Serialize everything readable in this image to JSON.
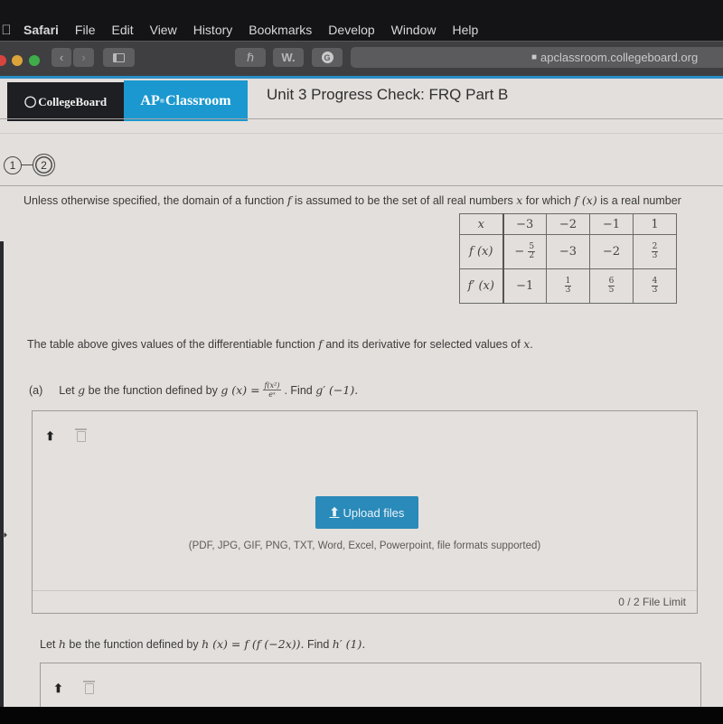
{
  "menubar": {
    "apple_icon": "apple-icon",
    "items": [
      "Safari",
      "File",
      "Edit",
      "View",
      "History",
      "Bookmarks",
      "Develop",
      "Window",
      "Help"
    ]
  },
  "toolbar": {
    "back_glyph": "‹",
    "forward_glyph": "›",
    "ext1_glyph": "ℏ",
    "ext2_label": "W.",
    "ext3_glyph": "G",
    "url": "apclassroom.collegeboard.org",
    "lock_glyph": "🔒"
  },
  "header": {
    "brand": "CollegeBoard",
    "brand_icon": "acorn-shield-icon",
    "app_prefix": "AP",
    "app_sup": "®",
    "app_name": "Classroom",
    "title": "Unit 3 Progress Check: FRQ Part B"
  },
  "stepper": {
    "steps": [
      "1",
      "2"
    ],
    "current": "2"
  },
  "question": {
    "intro_prefix": "Unless otherwise specified, the domain of a function",
    "intro_f": "f",
    "intro_mid": "is assumed to be the set of all real numbers",
    "intro_x": "x",
    "intro_mid2": "for which",
    "intro_fx": "f (x)",
    "intro_suffix": "is a real number",
    "table": {
      "header_label": "x",
      "x_values": [
        "−3",
        "−2",
        "−1",
        "1"
      ],
      "rows": [
        {
          "label": "f (x)",
          "cells": [
            {
              "sign": "−",
              "num": "5",
              "den": "2"
            },
            {
              "text": "−3"
            },
            {
              "text": "−2"
            },
            {
              "num": "2",
              "den": "3"
            }
          ]
        },
        {
          "label": "f′ (x)",
          "cells": [
            {
              "text": "−1"
            },
            {
              "num": "1",
              "den": "3"
            },
            {
              "num": "6",
              "den": "5"
            },
            {
              "num": "4",
              "den": "3"
            }
          ]
        }
      ]
    },
    "caption_prefix": "The table above gives values of the differentiable function",
    "caption_f": "f",
    "caption_mid": "and its derivative for selected values of",
    "caption_x": "x",
    "caption_end": ".",
    "part_a": {
      "label": "(a)",
      "text_prefix": "Let",
      "g": "g",
      "text_mid": "be the function defined by",
      "lhs": "g (x) =",
      "frac_num": "f(x²)",
      "frac_den": "eˣ",
      "text_find": ". Find",
      "target": "g′ (−1)."
    },
    "part_b": {
      "text_prefix": "Let",
      "h": "h",
      "text_mid": "be the function defined by",
      "expr": "h (x) = f (f (−2x)).",
      "text_find": "Find",
      "target": "h′ (1)."
    }
  },
  "upload": {
    "upload_icon": "upload-icon",
    "trash_icon": "trash-icon",
    "button_label": "Upload files",
    "button_icon_glyph": "⬆",
    "formats": "(PDF, JPG, GIF, PNG, TXT, Word, Excel, Powerpoint, file formats supported)",
    "file_limit": "0 / 2 File Limit"
  },
  "colors": {
    "ap_blue": "#1a98cf",
    "upload_blue": "#2a8ab9",
    "brand_dark": "#1d1f23",
    "page_bg": "#e3dfdc"
  }
}
